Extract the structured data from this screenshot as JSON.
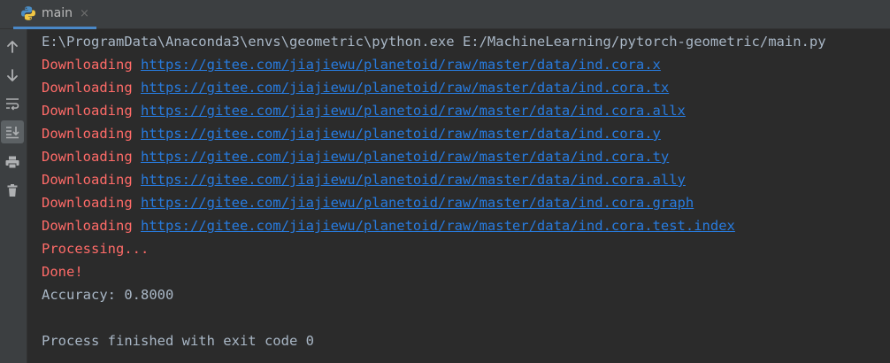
{
  "tab": {
    "label": "main",
    "close_glyph": "×",
    "icon": "python-icon"
  },
  "sidebar": {
    "tools": [
      {
        "name": "up-arrow-icon"
      },
      {
        "name": "down-arrow-icon"
      },
      {
        "name": "soft-wrap-icon"
      },
      {
        "name": "scroll-to-end-icon"
      },
      {
        "name": "print-icon"
      },
      {
        "name": "trash-icon"
      }
    ]
  },
  "console": {
    "command": "E:\\ProgramData\\Anaconda3\\envs\\geometric\\python.exe E:/MachineLearning/pytorch-geometric/main.py",
    "download_prefix": "Downloading ",
    "downloads": [
      "https://gitee.com/jiajiewu/planetoid/raw/master/data/ind.cora.x",
      "https://gitee.com/jiajiewu/planetoid/raw/master/data/ind.cora.tx",
      "https://gitee.com/jiajiewu/planetoid/raw/master/data/ind.cora.allx",
      "https://gitee.com/jiajiewu/planetoid/raw/master/data/ind.cora.y",
      "https://gitee.com/jiajiewu/planetoid/raw/master/data/ind.cora.ty",
      "https://gitee.com/jiajiewu/planetoid/raw/master/data/ind.cora.ally",
      "https://gitee.com/jiajiewu/planetoid/raw/master/data/ind.cora.graph",
      "https://gitee.com/jiajiewu/planetoid/raw/master/data/ind.cora.test.index"
    ],
    "processing": "Processing...",
    "done": "Done!",
    "accuracy": "Accuracy: 0.8000",
    "exit_message": "Process finished with exit code 0"
  },
  "colors": {
    "background": "#2b2b2b",
    "panel": "#3c3f41",
    "text": "#a9b7c6",
    "error": "#ff6b68",
    "link": "#287bde"
  }
}
